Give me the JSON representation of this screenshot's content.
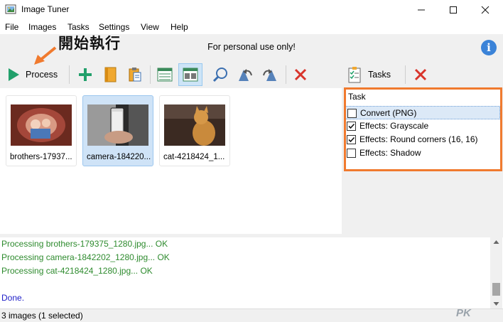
{
  "window": {
    "title": "Image Tuner"
  },
  "menu": [
    "File",
    "Images",
    "Tasks",
    "Settings",
    "View",
    "Help"
  ],
  "banner": {
    "text": "For personal use only!",
    "annotation": "開始執行"
  },
  "toolbar": {
    "process_label": "Process",
    "tasks_label": "Tasks"
  },
  "images": [
    {
      "name": "brothers-17937...",
      "selected": false
    },
    {
      "name": "camera-184220...",
      "selected": true
    },
    {
      "name": "cat-4218424_1...",
      "selected": false
    }
  ],
  "tasks": {
    "header": "Task",
    "items": [
      {
        "label": "Convert (PNG)",
        "checked": false,
        "selected": true
      },
      {
        "label": "Effects: Grayscale",
        "checked": true,
        "selected": false
      },
      {
        "label": "Effects: Round corners (16, 16)",
        "checked": true,
        "selected": false
      },
      {
        "label": "Effects: Shadow",
        "checked": false,
        "selected": false
      }
    ]
  },
  "log": [
    {
      "text": "Processing brothers-179375_1280.jpg... OK",
      "color": "#2e8b2e"
    },
    {
      "text": "Processing camera-1842202_1280.jpg... OK",
      "color": "#2e8b2e"
    },
    {
      "text": "Processing cat-4218424_1280.jpg... OK",
      "color": "#2e8b2e"
    },
    {
      "text": "",
      "color": "#2e8b2e"
    },
    {
      "text": "Done.",
      "color": "#2020c8"
    }
  ],
  "status": {
    "text": "3 images (1 selected)"
  },
  "watermark": "PK",
  "colors": {
    "accent": "#f07a2e",
    "process_green": "#22a06b",
    "delete_red": "#d9342b",
    "info_blue": "#3b83d8"
  }
}
